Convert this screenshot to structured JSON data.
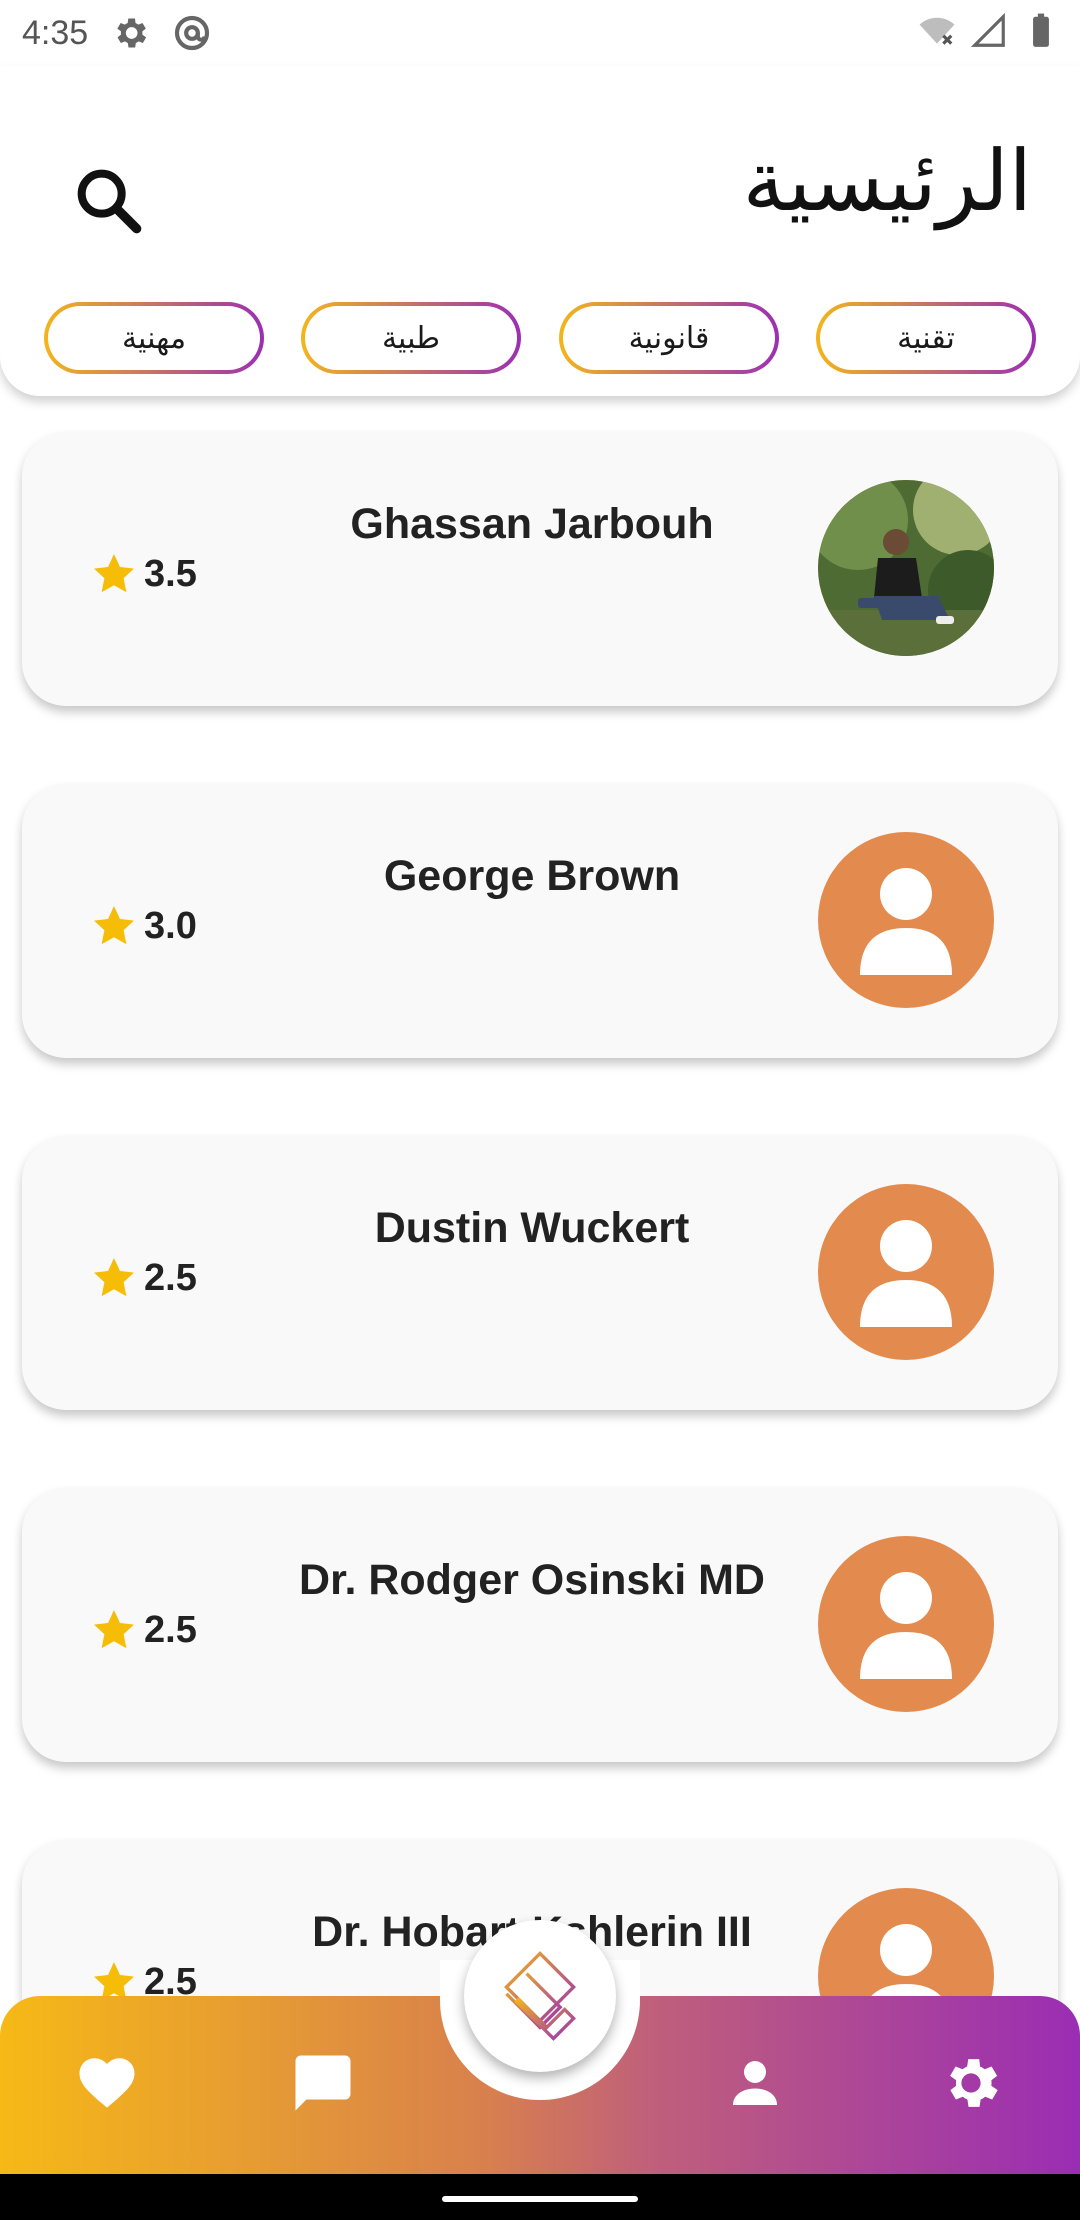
{
  "status_bar": {
    "time": "4:35"
  },
  "header": {
    "title": "الرئيسية",
    "categories": [
      "تقنية",
      "قانونية",
      "طبية",
      "مهنية"
    ]
  },
  "experts": [
    {
      "name": "Ghassan Jarbouh",
      "rating": "3.5",
      "avatar": "photo"
    },
    {
      "name": "George Brown",
      "rating": "3.0",
      "avatar": "placeholder"
    },
    {
      "name": "Dustin Wuckert",
      "rating": "2.5",
      "avatar": "placeholder"
    },
    {
      "name": "Dr. Rodger Osinski MD",
      "rating": "2.5",
      "avatar": "placeholder"
    },
    {
      "name": "Dr. Hobart Kshlerin III",
      "rating": "2.5",
      "avatar": "placeholder"
    }
  ],
  "bottom_nav": {
    "items": [
      "heart-icon",
      "chat-icon",
      "logo-icon",
      "person-icon",
      "gear-icon"
    ]
  },
  "colors": {
    "accent_orange": "#e38b4e",
    "gradient_start": "#f6b916",
    "gradient_end": "#9a2db4",
    "star": "#f5bd07"
  }
}
